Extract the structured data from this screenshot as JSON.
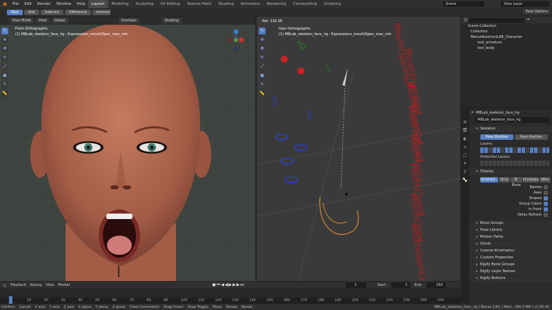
{
  "top_menu": [
    "File",
    "Edit",
    "Render",
    "Window",
    "Help"
  ],
  "workspaces": [
    "Layout",
    "Modeling",
    "Sculpting",
    "UV Editing",
    "Texture Paint",
    "Shading",
    "Animation",
    "Rendering",
    "Compositing",
    "Scripting"
  ],
  "scene_label": "Scene",
  "view_layer_label": "View Layer",
  "pose_options_label": "Pose Options",
  "bool_ops": [
    "New",
    "Add",
    "Subtract",
    "Difference",
    "Intersect"
  ],
  "viewport1": {
    "mode": "Pose Mode",
    "view": "View",
    "transform": "Global",
    "overlays": "Overlays",
    "shading": "Shading",
    "title": "Front Orthographic",
    "subtitle": "(1) MBLab_skeleton_face_rig : Expressions_mouthOpen_max_min"
  },
  "viewport2": {
    "rot": "Rot: 216.36",
    "title": "User Orthographic",
    "subtitle": "(1) MBLab_skeleton_face_rig : Expressions_mouthOpen_max_min",
    "labels": [
      "MouthOpenHalf",
      "MouthOpenAggr",
      "MouthLowerOut",
      "MouthInflated",
      "MouthHoriz",
      "MouthClosed",
      "MouthChew",
      "MouthOpenLarge"
    ]
  },
  "outliner": {
    "rows": [
      "Scene Collection",
      "Collection",
      "ManuelbastioniLAB_Character",
      "test_armature",
      "test_body"
    ]
  },
  "properties": {
    "object_name": "MBLab_skeleton_face_rig",
    "field_name": "MBLab_skeleton_face_rig",
    "skeleton_header": "Skeleton",
    "pose_position": "Pose Position",
    "rest_position": "Rest Position",
    "layers_label": "Layers:",
    "protected_layers_label": "Protected Layers:",
    "display_header": "Display",
    "display_tabs": [
      "Octahed...",
      "Stick",
      "B-Bone",
      "Envelope",
      "Wire"
    ],
    "display_options": [
      "Names",
      "Axes",
      "Shapes",
      "Group Colors",
      "In Front",
      "Delay Refresh"
    ],
    "display_checked": [
      false,
      false,
      true,
      true,
      true,
      false
    ],
    "sections": [
      "Bone Groups",
      "Pose Library",
      "Motion Paths",
      "Ghost",
      "Inverse Kinematics",
      "Custom Properties",
      "Rigify Bone Groups",
      "Rigify Layer Names",
      "Rigify Buttons"
    ]
  },
  "timeline": {
    "menus": [
      "Playback",
      "Keying",
      "View",
      "Marker"
    ],
    "current_frame": "1",
    "start_label": "Start:",
    "start": "1",
    "end_label": "End:",
    "end": "250",
    "ticks": [
      "0",
      "10",
      "20",
      "30",
      "40",
      "50",
      "60",
      "70",
      "80",
      "90",
      "100",
      "110",
      "120",
      "130",
      "140",
      "150",
      "160",
      "170",
      "180",
      "190",
      "200",
      "210",
      "220",
      "230",
      "240",
      "250"
    ]
  },
  "statusbar": {
    "items": [
      "Confirm",
      "Cancel",
      "X axis",
      "Y axis",
      "Z axis",
      "X plane",
      "Y plane",
      "Z plane",
      "Clear Constraints",
      "Snap Invert",
      "Snap Toggle",
      "Move",
      "Rotate",
      "Resize"
    ],
    "right_text": "MBLab_skeleton_face_rig | Bones:1/62 | Mem: 189.3 MB | v2.80.40"
  },
  "colors": {
    "accent": "#5680c2",
    "bone_red": "#cc2222",
    "bone_blue": "#2f3fb0",
    "text_3d": "#b02020"
  }
}
